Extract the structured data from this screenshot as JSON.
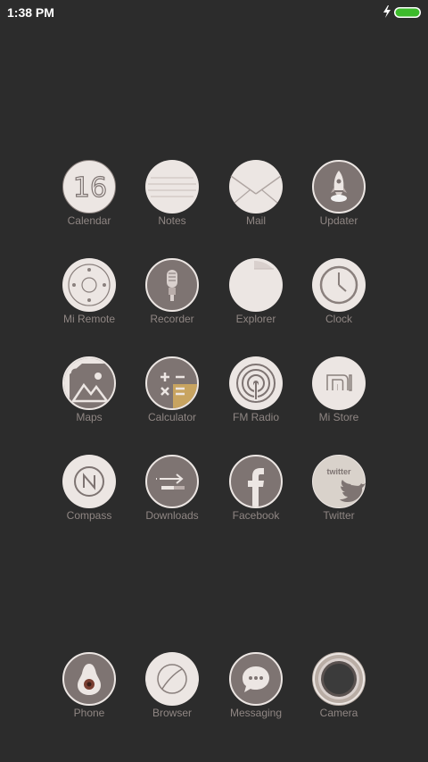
{
  "status_bar": {
    "time": "1:38 PM",
    "battery_color": "#3dbb2c"
  },
  "apps": [
    {
      "label": "Calendar",
      "icon": "calendar-icon",
      "number": "16"
    },
    {
      "label": "Notes",
      "icon": "notes-icon"
    },
    {
      "label": "Mail",
      "icon": "mail-icon"
    },
    {
      "label": "Updater",
      "icon": "rocket-icon"
    },
    {
      "label": "Mi Remote",
      "icon": "remote-icon"
    },
    {
      "label": "Recorder",
      "icon": "microphone-icon"
    },
    {
      "label": "Explorer",
      "icon": "folder-icon"
    },
    {
      "label": "Clock",
      "icon": "clock-icon"
    },
    {
      "label": "Maps",
      "icon": "maps-icon"
    },
    {
      "label": "Calculator",
      "icon": "calculator-icon"
    },
    {
      "label": "FM Radio",
      "icon": "radio-icon"
    },
    {
      "label": "Mi Store",
      "icon": "mi-logo-icon",
      "logo_text": "mi"
    },
    {
      "label": "Compass",
      "icon": "compass-icon"
    },
    {
      "label": "Downloads",
      "icon": "download-icon"
    },
    {
      "label": "Facebook",
      "icon": "facebook-icon"
    },
    {
      "label": "Twitter",
      "icon": "twitter-icon",
      "logo_text": "twitter"
    }
  ],
  "dock": [
    {
      "label": "Phone",
      "icon": "phone-icon"
    },
    {
      "label": "Browser",
      "icon": "browser-icon"
    },
    {
      "label": "Messaging",
      "icon": "message-icon"
    },
    {
      "label": "Camera",
      "icon": "camera-icon"
    }
  ],
  "colors": {
    "background": "#2c2c2c",
    "icon_light": "#ece6e3",
    "icon_dark": "#7e7472",
    "icon_gold": "#c8a460",
    "label": "#8f8683"
  }
}
